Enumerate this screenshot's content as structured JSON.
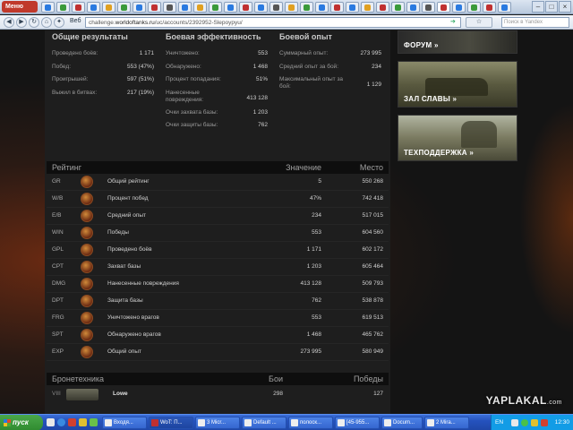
{
  "browser": {
    "menu_label": "Меню",
    "web_label": "Веб",
    "url_prefix": "challenge.",
    "url_domain": "worldoftanks.ru",
    "url_path": "/uc/accounts/2392952-Slepoypyu/",
    "search_placeholder": "Поиск в Yandex"
  },
  "summary": {
    "col1": {
      "title": "Общие результаты",
      "rows": [
        {
          "label": "Проведено боёв:",
          "value": "1 171"
        },
        {
          "label": "Побед:",
          "value": "553 (47%)"
        },
        {
          "label": "Проигрышей:",
          "value": "597 (51%)"
        },
        {
          "label": "Выжил в битвах:",
          "value": "217 (19%)"
        }
      ]
    },
    "col2": {
      "title": "Боевая эффективность",
      "rows": [
        {
          "label": "Уничтожено:",
          "value": "553"
        },
        {
          "label": "Обнаружено:",
          "value": "1 468"
        },
        {
          "label": "Процент попадания:",
          "value": "51%"
        },
        {
          "label": "Нанесенные повреждения:",
          "value": "413 128"
        },
        {
          "label": "Очки захвата базы:",
          "value": "1 203"
        },
        {
          "label": "Очки защиты базы:",
          "value": "762"
        }
      ]
    },
    "col3": {
      "title": "Боевой опыт",
      "rows": [
        {
          "label": "Суммарный опыт:",
          "value": "273 995"
        },
        {
          "label": "Средний опыт за бой:",
          "value": "234"
        },
        {
          "label": "Максимальный опыт за бой:",
          "value": "1 129"
        }
      ]
    }
  },
  "rating": {
    "title": "Рейтинг",
    "col_value": "Значение",
    "col_place": "Место",
    "rows": [
      {
        "code": "GR",
        "name": "Общий рейтинг",
        "value": "5",
        "place": "550 268"
      },
      {
        "code": "W/B",
        "name": "Процент побед",
        "value": "47%",
        "place": "742 418"
      },
      {
        "code": "E/B",
        "name": "Средний опыт",
        "value": "234",
        "place": "517 015"
      },
      {
        "code": "WIN",
        "name": "Победы",
        "value": "553",
        "place": "604 560"
      },
      {
        "code": "GPL",
        "name": "Проведено боёв",
        "value": "1 171",
        "place": "602 172"
      },
      {
        "code": "CPT",
        "name": "Захват базы",
        "value": "1 203",
        "place": "605 464"
      },
      {
        "code": "DMG",
        "name": "Нанесенные повреждения",
        "value": "413 128",
        "place": "509 793"
      },
      {
        "code": "DPT",
        "name": "Защита базы",
        "value": "762",
        "place": "538 878"
      },
      {
        "code": "FRG",
        "name": "Уничтожено врагов",
        "value": "553",
        "place": "619 513"
      },
      {
        "code": "SPT",
        "name": "Обнаружено врагов",
        "value": "1 468",
        "place": "465 762"
      },
      {
        "code": "EXP",
        "name": "Общий опыт",
        "value": "273 995",
        "place": "580 949"
      }
    ]
  },
  "tech": {
    "title": "Бронетехника",
    "col_battles": "Бои",
    "col_wins": "Победы",
    "rows": [
      {
        "tier": "VIII",
        "name": "Lowe",
        "battles": "298",
        "wins": "127"
      }
    ]
  },
  "banners": {
    "forum": "ФОРУМ »",
    "hall": "ЗАЛ СЛАВЫ »",
    "support": "ТЕХПОДДЕРЖКА »"
  },
  "watermark": {
    "main": "YAPLAKAL",
    "suffix": ".com"
  },
  "taskbar": {
    "start": "пуск",
    "buttons": [
      "Входя...",
      "WoT: П...",
      "3 Micr...",
      "Default ...",
      "полоск...",
      "[45-955...",
      "Docum...",
      "2 Mira..."
    ],
    "lang": "EN",
    "clock": "12:30"
  },
  "colors": {
    "accent": "#c0392b",
    "taskbar": "#2552bd",
    "page_bg": "#1e1e1e"
  }
}
